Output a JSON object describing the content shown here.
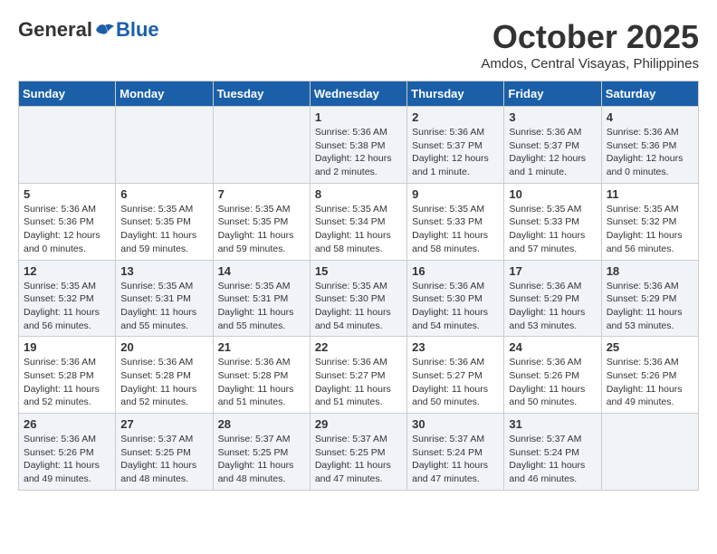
{
  "logo": {
    "general": "General",
    "blue": "Blue"
  },
  "title": {
    "month_year": "October 2025",
    "location": "Amdos, Central Visayas, Philippines"
  },
  "weekdays": [
    "Sunday",
    "Monday",
    "Tuesday",
    "Wednesday",
    "Thursday",
    "Friday",
    "Saturday"
  ],
  "weeks": [
    [
      {
        "day": "",
        "info": ""
      },
      {
        "day": "",
        "info": ""
      },
      {
        "day": "",
        "info": ""
      },
      {
        "day": "1",
        "info": "Sunrise: 5:36 AM\nSunset: 5:38 PM\nDaylight: 12 hours\nand 2 minutes."
      },
      {
        "day": "2",
        "info": "Sunrise: 5:36 AM\nSunset: 5:37 PM\nDaylight: 12 hours\nand 1 minute."
      },
      {
        "day": "3",
        "info": "Sunrise: 5:36 AM\nSunset: 5:37 PM\nDaylight: 12 hours\nand 1 minute."
      },
      {
        "day": "4",
        "info": "Sunrise: 5:36 AM\nSunset: 5:36 PM\nDaylight: 12 hours\nand 0 minutes."
      }
    ],
    [
      {
        "day": "5",
        "info": "Sunrise: 5:36 AM\nSunset: 5:36 PM\nDaylight: 12 hours\nand 0 minutes."
      },
      {
        "day": "6",
        "info": "Sunrise: 5:35 AM\nSunset: 5:35 PM\nDaylight: 11 hours\nand 59 minutes."
      },
      {
        "day": "7",
        "info": "Sunrise: 5:35 AM\nSunset: 5:35 PM\nDaylight: 11 hours\nand 59 minutes."
      },
      {
        "day": "8",
        "info": "Sunrise: 5:35 AM\nSunset: 5:34 PM\nDaylight: 11 hours\nand 58 minutes."
      },
      {
        "day": "9",
        "info": "Sunrise: 5:35 AM\nSunset: 5:33 PM\nDaylight: 11 hours\nand 58 minutes."
      },
      {
        "day": "10",
        "info": "Sunrise: 5:35 AM\nSunset: 5:33 PM\nDaylight: 11 hours\nand 57 minutes."
      },
      {
        "day": "11",
        "info": "Sunrise: 5:35 AM\nSunset: 5:32 PM\nDaylight: 11 hours\nand 56 minutes."
      }
    ],
    [
      {
        "day": "12",
        "info": "Sunrise: 5:35 AM\nSunset: 5:32 PM\nDaylight: 11 hours\nand 56 minutes."
      },
      {
        "day": "13",
        "info": "Sunrise: 5:35 AM\nSunset: 5:31 PM\nDaylight: 11 hours\nand 55 minutes."
      },
      {
        "day": "14",
        "info": "Sunrise: 5:35 AM\nSunset: 5:31 PM\nDaylight: 11 hours\nand 55 minutes."
      },
      {
        "day": "15",
        "info": "Sunrise: 5:35 AM\nSunset: 5:30 PM\nDaylight: 11 hours\nand 54 minutes."
      },
      {
        "day": "16",
        "info": "Sunrise: 5:36 AM\nSunset: 5:30 PM\nDaylight: 11 hours\nand 54 minutes."
      },
      {
        "day": "17",
        "info": "Sunrise: 5:36 AM\nSunset: 5:29 PM\nDaylight: 11 hours\nand 53 minutes."
      },
      {
        "day": "18",
        "info": "Sunrise: 5:36 AM\nSunset: 5:29 PM\nDaylight: 11 hours\nand 53 minutes."
      }
    ],
    [
      {
        "day": "19",
        "info": "Sunrise: 5:36 AM\nSunset: 5:28 PM\nDaylight: 11 hours\nand 52 minutes."
      },
      {
        "day": "20",
        "info": "Sunrise: 5:36 AM\nSunset: 5:28 PM\nDaylight: 11 hours\nand 52 minutes."
      },
      {
        "day": "21",
        "info": "Sunrise: 5:36 AM\nSunset: 5:28 PM\nDaylight: 11 hours\nand 51 minutes."
      },
      {
        "day": "22",
        "info": "Sunrise: 5:36 AM\nSunset: 5:27 PM\nDaylight: 11 hours\nand 51 minutes."
      },
      {
        "day": "23",
        "info": "Sunrise: 5:36 AM\nSunset: 5:27 PM\nDaylight: 11 hours\nand 50 minutes."
      },
      {
        "day": "24",
        "info": "Sunrise: 5:36 AM\nSunset: 5:26 PM\nDaylight: 11 hours\nand 50 minutes."
      },
      {
        "day": "25",
        "info": "Sunrise: 5:36 AM\nSunset: 5:26 PM\nDaylight: 11 hours\nand 49 minutes."
      }
    ],
    [
      {
        "day": "26",
        "info": "Sunrise: 5:36 AM\nSunset: 5:26 PM\nDaylight: 11 hours\nand 49 minutes."
      },
      {
        "day": "27",
        "info": "Sunrise: 5:37 AM\nSunset: 5:25 PM\nDaylight: 11 hours\nand 48 minutes."
      },
      {
        "day": "28",
        "info": "Sunrise: 5:37 AM\nSunset: 5:25 PM\nDaylight: 11 hours\nand 48 minutes."
      },
      {
        "day": "29",
        "info": "Sunrise: 5:37 AM\nSunset: 5:25 PM\nDaylight: 11 hours\nand 47 minutes."
      },
      {
        "day": "30",
        "info": "Sunrise: 5:37 AM\nSunset: 5:24 PM\nDaylight: 11 hours\nand 47 minutes."
      },
      {
        "day": "31",
        "info": "Sunrise: 5:37 AM\nSunset: 5:24 PM\nDaylight: 11 hours\nand 46 minutes."
      },
      {
        "day": "",
        "info": ""
      }
    ]
  ]
}
